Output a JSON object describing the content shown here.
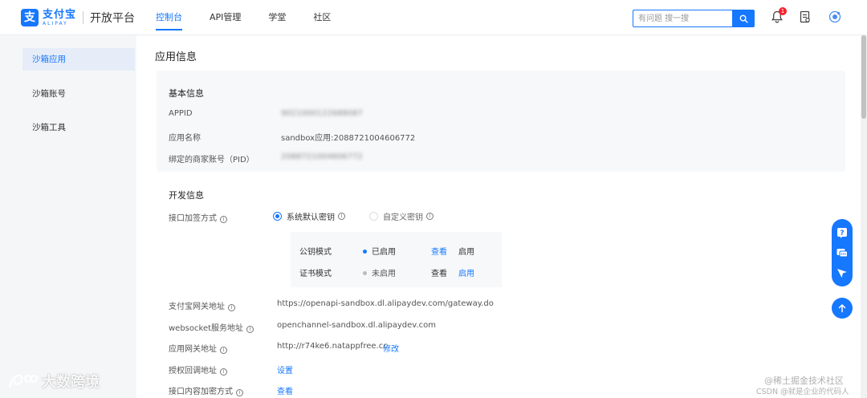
{
  "header": {
    "logo_mark": "支",
    "logo_cn": "支付宝",
    "logo_en": "ALIPAY",
    "platform": "开放平台",
    "nav": [
      {
        "label": "控制台",
        "active": true
      },
      {
        "label": "API管理",
        "active": false
      },
      {
        "label": "学堂",
        "active": false
      },
      {
        "label": "社区",
        "active": false
      }
    ],
    "search": {
      "placeholder": "有问题 搜一搜"
    },
    "notification_count": "1",
    "icons": [
      "search-icon",
      "bell-icon",
      "document-icon",
      "avatar-icon"
    ]
  },
  "sidebar": {
    "items": [
      {
        "label": "沙箱应用",
        "active": true
      },
      {
        "label": "沙箱账号",
        "active": false
      },
      {
        "label": "沙箱工具",
        "active": false
      }
    ]
  },
  "page": {
    "title": "应用信息",
    "basic": {
      "title": "基本信息",
      "rows": [
        {
          "label": "APPID",
          "value": "9021000122688087"
        },
        {
          "label": "应用名称",
          "value": "sandbox应用:2088721004606772"
        },
        {
          "label": "绑定的商家账号（PID）",
          "value": "2088721004606772"
        }
      ]
    },
    "dev": {
      "title": "开发信息",
      "sign_label": "接口加签方式",
      "options": [
        {
          "label": "系统默认密钥",
          "checked": true
        },
        {
          "label": "自定义密钥",
          "checked": false
        }
      ],
      "modes": [
        {
          "label": "公钥模式",
          "status": "已启用",
          "enabled": true,
          "view": "查看",
          "action": "启用"
        },
        {
          "label": "证书模式",
          "status": "未启用",
          "enabled": false,
          "view": "查看",
          "action": "启用"
        }
      ],
      "fields": [
        {
          "label": "支付宝网关地址",
          "value": "https://openapi-sandbox.dl.alipaydev.com/gateway.do",
          "link": ""
        },
        {
          "label": "websocket服务地址",
          "value": "openchannel-sandbox.dl.alipaydev.com",
          "link": ""
        },
        {
          "label": "应用网关地址",
          "value": "http://r74ke6.natappfree.cc",
          "link": "修改"
        },
        {
          "label": "授权回调地址",
          "value": "",
          "link": "设置"
        },
        {
          "label": "接口内容加密方式",
          "value": "",
          "link": "查看"
        }
      ]
    }
  },
  "floating": {
    "buttons": [
      "help-icon",
      "chat-icon",
      "feedback-icon"
    ],
    "top_icon": "arrow-up-icon"
  },
  "watermarks": {
    "left": "大数跨境",
    "right1": "@稀土掘金技术社区",
    "right2": "CSDN @就是企业的代码人"
  },
  "colors": {
    "accent": "#1677ff",
    "sidebar_active_bg": "#e6edf8",
    "card_bg": "#f7f8fa",
    "badge": "#f5222d"
  }
}
